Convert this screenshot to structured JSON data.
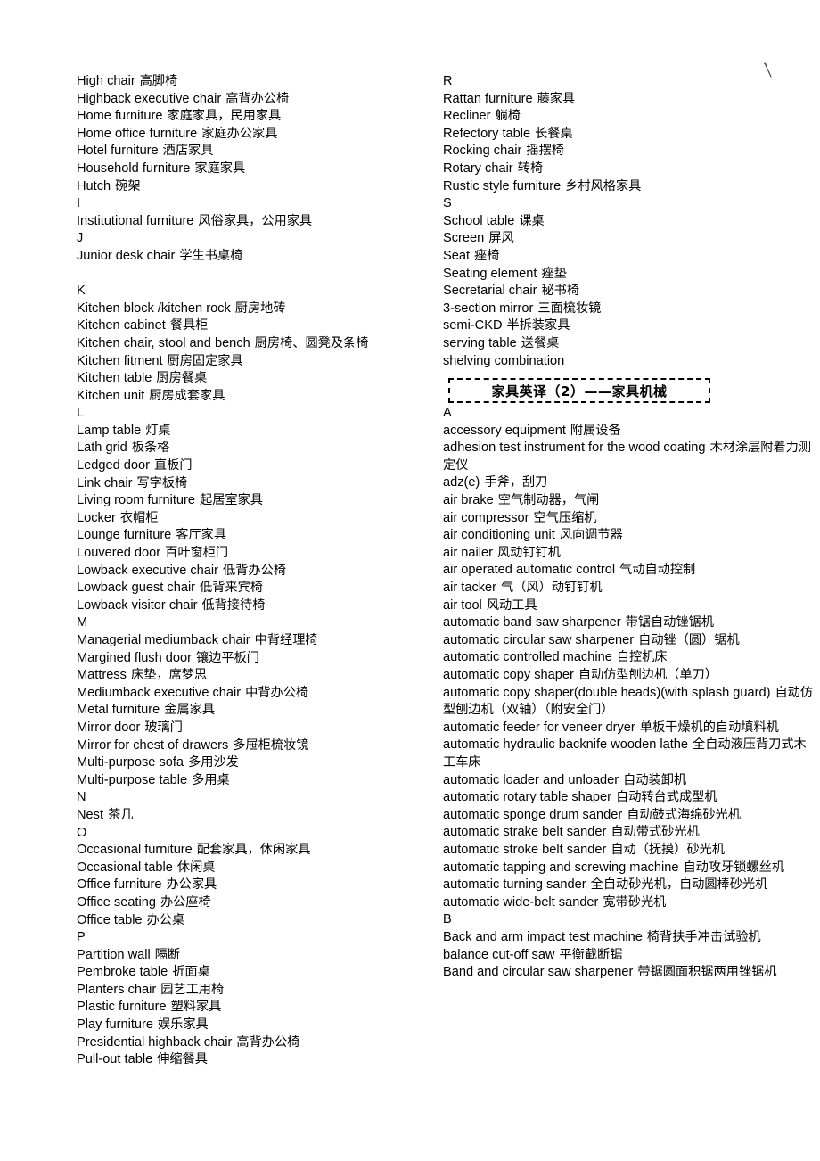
{
  "document": {
    "title": "家具英译词汇表",
    "background_color": "#ffffff",
    "text_color": "#000000",
    "stray_mark": "diagonal-pen-stroke"
  },
  "banner": {
    "title": "家具英译（2）——家具机械",
    "border_style": "dashed",
    "border_color": "#000000"
  },
  "left_column": {
    "entries": [
      {
        "en": "High chair",
        "cn": "高脚椅"
      },
      {
        "en": "Highback executive chair",
        "cn": "高背办公椅"
      },
      {
        "en": "Home furniture",
        "cn": "家庭家具，民用家具"
      },
      {
        "en": "Home office furniture",
        "cn": "家庭办公家具"
      },
      {
        "en": "Hotel furniture",
        "cn": "酒店家具"
      },
      {
        "en": "Household furniture",
        "cn": "家庭家具"
      },
      {
        "en": "Hutch",
        "cn": "碗架"
      },
      {
        "en": "I",
        "cn": ""
      },
      {
        "en": "Institutional furniture",
        "cn": "风俗家具，公用家具"
      },
      {
        "en": "J",
        "cn": ""
      },
      {
        "en": "Junior desk chair",
        "cn": "学生书桌椅"
      },
      {
        "en": "",
        "cn": ""
      },
      {
        "en": "K",
        "cn": ""
      },
      {
        "en": "Kitchen block /kitchen rock",
        "cn": "厨房地砖"
      },
      {
        "en": "Kitchen cabinet",
        "cn": "餐具柜"
      },
      {
        "en": "Kitchen chair, stool and bench",
        "cn": "厨房椅、圆凳及条椅"
      },
      {
        "en": "Kitchen fitment",
        "cn": "厨房固定家具"
      },
      {
        "en": "Kitchen table",
        "cn": "厨房餐桌"
      },
      {
        "en": "Kitchen unit",
        "cn": "厨房成套家具"
      },
      {
        "en": "L",
        "cn": ""
      },
      {
        "en": "Lamp table",
        "cn": "灯桌"
      },
      {
        "en": "Lath grid",
        "cn": "板条格"
      },
      {
        "en": "Ledged door",
        "cn": "直板门"
      },
      {
        "en": "Link chair",
        "cn": "写字板椅"
      },
      {
        "en": "Living room furniture",
        "cn": "起居室家具"
      },
      {
        "en": "Locker",
        "cn": "衣帽柜"
      },
      {
        "en": "Lounge furniture",
        "cn": "客厅家具"
      },
      {
        "en": "Louvered door",
        "cn": "百叶窗柜门"
      },
      {
        "en": "Lowback executive chair",
        "cn": "低背办公椅"
      },
      {
        "en": "Lowback guest chair",
        "cn": "低背来宾椅"
      },
      {
        "en": "Lowback visitor chair",
        "cn": "低背接待椅"
      },
      {
        "en": "M",
        "cn": ""
      },
      {
        "en": "Managerial mediumback chair",
        "cn": "中背经理椅"
      },
      {
        "en": "Margined flush door",
        "cn": "镶边平板门"
      },
      {
        "en": "Mattress",
        "cn": "床垫，席梦思"
      },
      {
        "en": "Mediumback executive chair",
        "cn": "中背办公椅"
      },
      {
        "en": "Metal furniture",
        "cn": "金属家具"
      },
      {
        "en": "Mirror door",
        "cn": "玻璃门"
      },
      {
        "en": "Mirror for chest of drawers",
        "cn": "多屉柜梳妆镜"
      },
      {
        "en": "Multi-purpose sofa",
        "cn": "多用沙发"
      },
      {
        "en": "Multi-purpose table",
        "cn": "多用桌"
      },
      {
        "en": "N",
        "cn": ""
      },
      {
        "en": "Nest",
        "cn": "茶几"
      },
      {
        "en": "O",
        "cn": ""
      },
      {
        "en": "Occasional furniture",
        "cn": "配套家具，休闲家具"
      },
      {
        "en": "Occasional table",
        "cn": "休闲桌"
      },
      {
        "en": "Office furniture",
        "cn": "办公家具"
      },
      {
        "en": "Office seating",
        "cn": "办公座椅"
      },
      {
        "en": "Office table",
        "cn": "办公桌"
      },
      {
        "en": "P",
        "cn": ""
      },
      {
        "en": "Partition wall",
        "cn": "隔断"
      },
      {
        "en": "Pembroke table",
        "cn": "折面桌"
      },
      {
        "en": "Planters chair",
        "cn": "园艺工用椅"
      },
      {
        "en": "Plastic furniture",
        "cn": "塑料家具"
      },
      {
        "en": "Play furniture",
        "cn": "娱乐家具"
      },
      {
        "en": "Presidential highback chair",
        "cn": "高背办公椅"
      },
      {
        "en": "Pull-out table",
        "cn": "伸缩餐具"
      }
    ]
  },
  "right_column_top": {
    "entries": [
      {
        "en": "R",
        "cn": ""
      },
      {
        "en": "Rattan furniture",
        "cn": "藤家具"
      },
      {
        "en": "Recliner",
        "cn": "躺椅"
      },
      {
        "en": "Refectory table",
        "cn": "长餐桌"
      },
      {
        "en": "Rocking chair",
        "cn": "摇摆椅"
      },
      {
        "en": "Rotary chair",
        "cn": "转椅"
      },
      {
        "en": "Rustic style furniture",
        "cn": "乡村风格家具"
      },
      {
        "en": "S",
        "cn": ""
      },
      {
        "en": "School table",
        "cn": "课桌"
      },
      {
        "en": "Screen",
        "cn": "屏风"
      },
      {
        "en": "Seat",
        "cn": "痤椅"
      },
      {
        "en": "Seating element",
        "cn": "痤垫"
      },
      {
        "en": "Secretarial chair",
        "cn": "秘书椅"
      },
      {
        "en": "3-section mirror",
        "cn": "三面梳妆镜"
      },
      {
        "en": "semi-CKD",
        "cn": "半拆装家具"
      },
      {
        "en": "serving table",
        "cn": "送餐桌"
      },
      {
        "en": "shelving combination",
        "cn": ""
      }
    ]
  },
  "right_column_bottom": {
    "entries": [
      {
        "en": "A",
        "cn": ""
      },
      {
        "en": "accessory equipment",
        "cn": "附属设备"
      },
      {
        "en": "adhesion test instrument for the wood coating",
        "cn": "木材涂层附着力测定仪"
      },
      {
        "en": "adz(e)",
        "cn": "手斧，刮刀"
      },
      {
        "en": "air brake",
        "cn": "空气制动器，气闸"
      },
      {
        "en": "air compressor",
        "cn": "空气压缩机"
      },
      {
        "en": "air conditioning unit",
        "cn": "风向调节器"
      },
      {
        "en": "air nailer",
        "cn": "风动钉钉机"
      },
      {
        "en": "air operated automatic control",
        "cn": "气动自动控制"
      },
      {
        "en": "air tacker",
        "cn": "气（风）动钉钉机"
      },
      {
        "en": "air tool",
        "cn": "风动工具"
      },
      {
        "en": "automatic band saw sharpener",
        "cn": "带锯自动锉锯机"
      },
      {
        "en": "automatic circular saw sharpener",
        "cn": "自动锉（圆）锯机"
      },
      {
        "en": "automatic controlled machine",
        "cn": "自控机床"
      },
      {
        "en": "automatic copy shaper",
        "cn": "自动仿型刨边机（单刀）"
      },
      {
        "en": "automatic copy shaper(double heads)(with splash guard)",
        "cn": "自动仿型刨边机（双轴）（附安全门）"
      },
      {
        "en": "automatic feeder for veneer dryer",
        "cn": "单板干燥机的自动填料机"
      },
      {
        "en": "automatic hydraulic backnife wooden lathe",
        "cn": "全自动液压背刀式木工车床"
      },
      {
        "en": "automatic loader and unloader",
        "cn": "自动装卸机"
      },
      {
        "en": "automatic rotary table shaper",
        "cn": "自动转台式成型机"
      },
      {
        "en": "automatic sponge drum sander",
        "cn": "自动鼓式海绵砂光机"
      },
      {
        "en": "automatic strake belt sander",
        "cn": "自动带式砂光机"
      },
      {
        "en": "automatic stroke belt sander",
        "cn": "自动（抚摸）砂光机"
      },
      {
        "en": "automatic tapping and screwing machine",
        "cn": "自动攻牙锁螺丝机"
      },
      {
        "en": "automatic turning sander",
        "cn": "全自动砂光机，自动圆棒砂光机"
      },
      {
        "en": "automatic wide-belt sander",
        "cn": "宽带砂光机"
      },
      {
        "en": "B",
        "cn": ""
      },
      {
        "en": "Back and arm impact test machine",
        "cn": "椅背扶手冲击试验机"
      },
      {
        "en": "balance cut-off saw",
        "cn": "平衡截断锯"
      },
      {
        "en": "Band and circular saw sharpener",
        "cn": "带锯圆面积锯两用锉锯机"
      }
    ]
  }
}
